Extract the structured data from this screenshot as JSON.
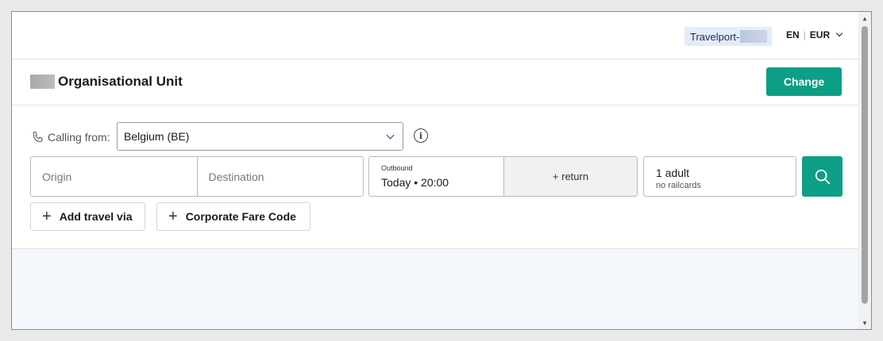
{
  "header": {
    "account_label": "Travelport-",
    "language": "EN",
    "separator": "|",
    "currency": "EUR"
  },
  "org": {
    "title": "Organisational Unit",
    "change_label": "Change"
  },
  "search": {
    "calling_from_label": "Calling from:",
    "country_value": "Belgium (BE)",
    "origin_placeholder": "Origin",
    "destination_placeholder": "Destination",
    "outbound_label": "Outbound",
    "outbound_value": "Today • 20:00",
    "return_label": "+ return",
    "passengers": "1 adult",
    "railcards": "no railcards",
    "add_travel_via": "Add travel via",
    "corporate_fare_code": "Corporate Fare Code"
  },
  "colors": {
    "accent": "#0d9e86",
    "account_pill": "#e3ecf9",
    "lower_panel": "#f4f7fc"
  }
}
